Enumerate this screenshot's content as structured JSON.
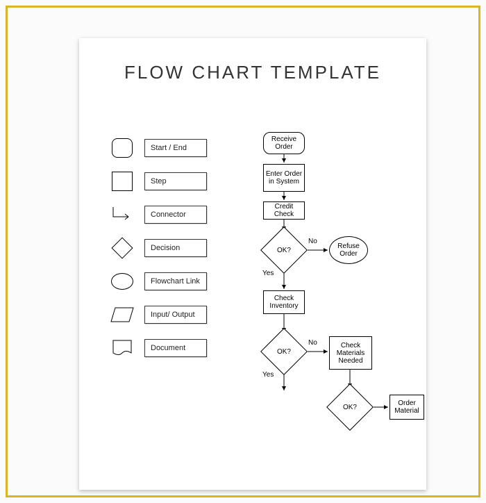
{
  "title": "FLOW CHART TEMPLATE",
  "legend": {
    "start_end": "Start / End",
    "step": "Step",
    "connector": "Connector",
    "decision": "Decision",
    "link": "Flowchart Link",
    "io": "Input/ Output",
    "document": "Document"
  },
  "flow": {
    "receive": "Receive Order",
    "enter": "Enter Order in System",
    "credit": "Credit Check",
    "ok1": "OK?",
    "refuse": "Refuse Order",
    "inventory": "Check Inventory",
    "ok2": "OK?",
    "materials": "Check Materials Needed",
    "ok3": "OK?",
    "order": "Order Material",
    "yes": "Yes",
    "no": "No"
  }
}
